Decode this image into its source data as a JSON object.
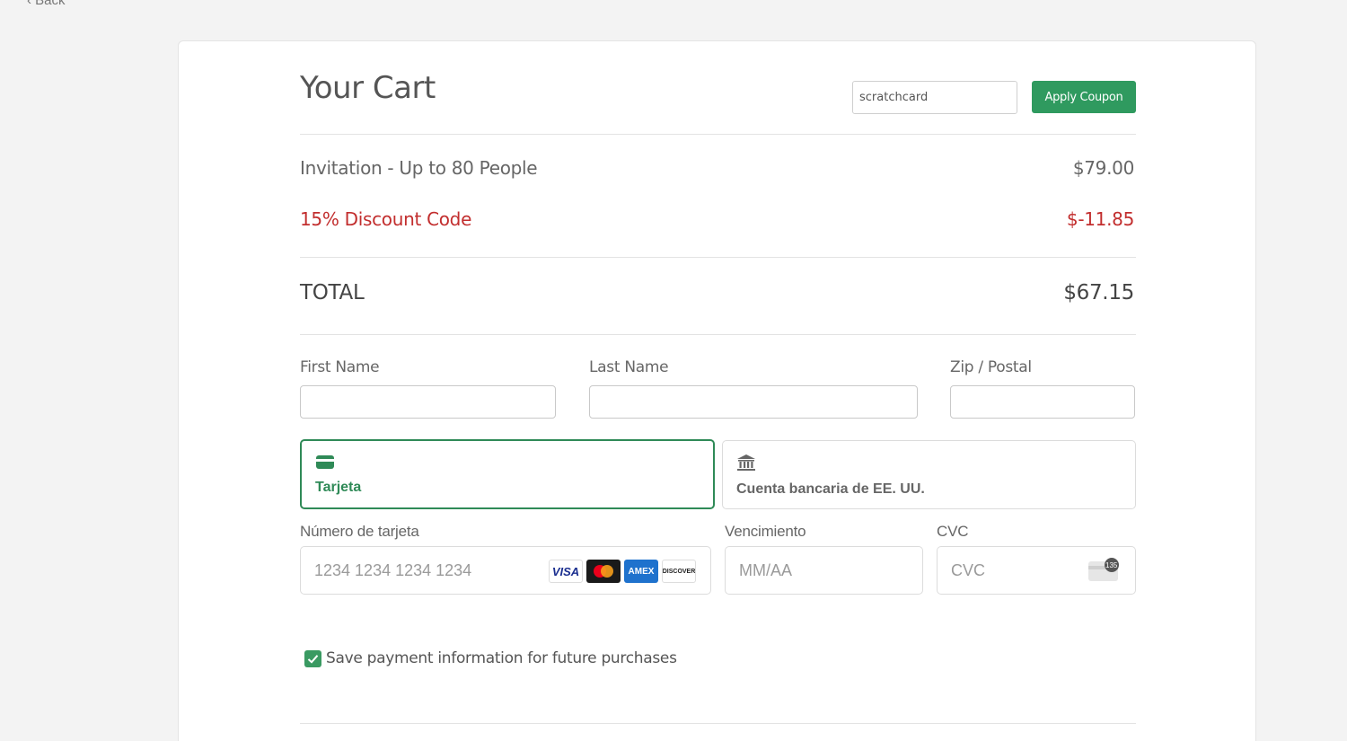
{
  "nav": {
    "back_label": "‹ Back"
  },
  "cart": {
    "title": "Your Cart",
    "coupon_value": "scratchcard",
    "apply_coupon_label": "Apply Coupon",
    "items": [
      {
        "label": "Invitation - Up to 80 People",
        "amount": "$79.00"
      }
    ],
    "discount": {
      "label": "15% Discount Code",
      "amount": "$-11.85",
      "color": "#c22e2e"
    },
    "total": {
      "label": "TOTAL",
      "amount": "$67.15"
    }
  },
  "billing": {
    "first_name_label": "First Name",
    "last_name_label": "Last Name",
    "zip_label": "Zip / Postal"
  },
  "payment": {
    "tabs": [
      {
        "label": "Tarjeta",
        "icon": "credit-card-icon",
        "selected": true
      },
      {
        "label": "Cuenta bancaria de EE. UU.",
        "icon": "bank-icon",
        "selected": false
      }
    ],
    "card_number_label": "Número de tarjeta",
    "card_number_placeholder": "1234 1234 1234 1234",
    "expiry_label": "Vencimiento",
    "expiry_placeholder": "MM/AA",
    "cvc_label": "CVC",
    "cvc_placeholder": "CVC",
    "card_brands": [
      "VISA",
      "Mastercard",
      "AMEX",
      "DISCOVER"
    ],
    "cvc_hint": "135",
    "accent_color": "#2f8a57"
  },
  "save_payment": {
    "label": "Save payment information for future purchases",
    "checked": true
  }
}
